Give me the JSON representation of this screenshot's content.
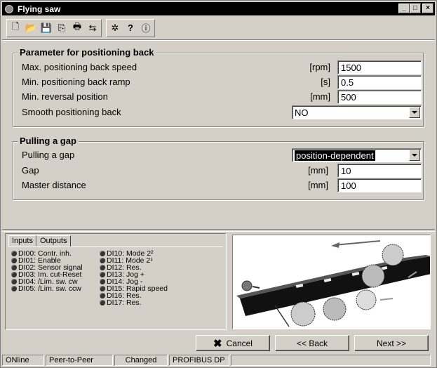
{
  "window": {
    "title": "Flying saw",
    "controls": [
      "_",
      "□",
      "×"
    ]
  },
  "toolbar": {
    "group1": [
      "new-file-icon",
      "open-folder-icon",
      "save-icon",
      "copy-icon",
      "print-icon",
      "export-icon"
    ],
    "group2": [
      "tools-icon",
      "help-icon",
      "info-icon"
    ],
    "glyphs": {
      "new": "🗋",
      "open": "📂",
      "save": "💾",
      "copy": "⎘",
      "print": "🖶",
      "export": "⇆",
      "tools": "✲",
      "help": "?",
      "info": "ⓘ"
    }
  },
  "positioning": {
    "title": "Parameter for positioning back",
    "rows": [
      {
        "label": "Max. positioning back speed",
        "unit": "[rpm]",
        "value": "1500"
      },
      {
        "label": "Min. positioning back ramp",
        "unit": "[s]",
        "value": "0.5"
      },
      {
        "label": "Min. reversal position",
        "unit": "[mm]",
        "value": "500"
      }
    ],
    "smooth": {
      "label": "Smooth positioning back",
      "value": "NO"
    }
  },
  "gap": {
    "title": "Pulling a gap",
    "select": {
      "label": "Pulling a gap",
      "value": "position-dependent"
    },
    "rows": [
      {
        "label": "Gap",
        "unit": "[mm]",
        "value": "10"
      },
      {
        "label": "Master distance",
        "unit": "[mm]",
        "value": "100"
      }
    ]
  },
  "io": {
    "tabs": [
      "Inputs",
      "Outputs"
    ],
    "col1": [
      "DI00: Contr. inh.",
      "DI01: Enable",
      "DI02: Sensor signal",
      "DI03: Im. cut-Reset",
      "DI04: /Lim. sw. cw",
      "DI05: /Lim. sw. ccw"
    ],
    "col2": [
      "DI10: Mode 2²",
      "DI11: Mode 2¹",
      "DI12: Res.",
      "DI13: Jog +",
      "DI14: Jog -",
      "DI15: Rapid speed",
      "DI16: Res.",
      "DI17: Res."
    ]
  },
  "buttons": {
    "cancel": "Cancel",
    "back": "<< Back",
    "next": "Next >>"
  },
  "status": {
    "online": "ONline",
    "mode": "Peer-to-Peer",
    "state": "Changed",
    "bus": "PROFIBUS DP"
  },
  "colors": {
    "face": "#d4d0c8",
    "titlebar": "#000000",
    "led": "#333333"
  }
}
